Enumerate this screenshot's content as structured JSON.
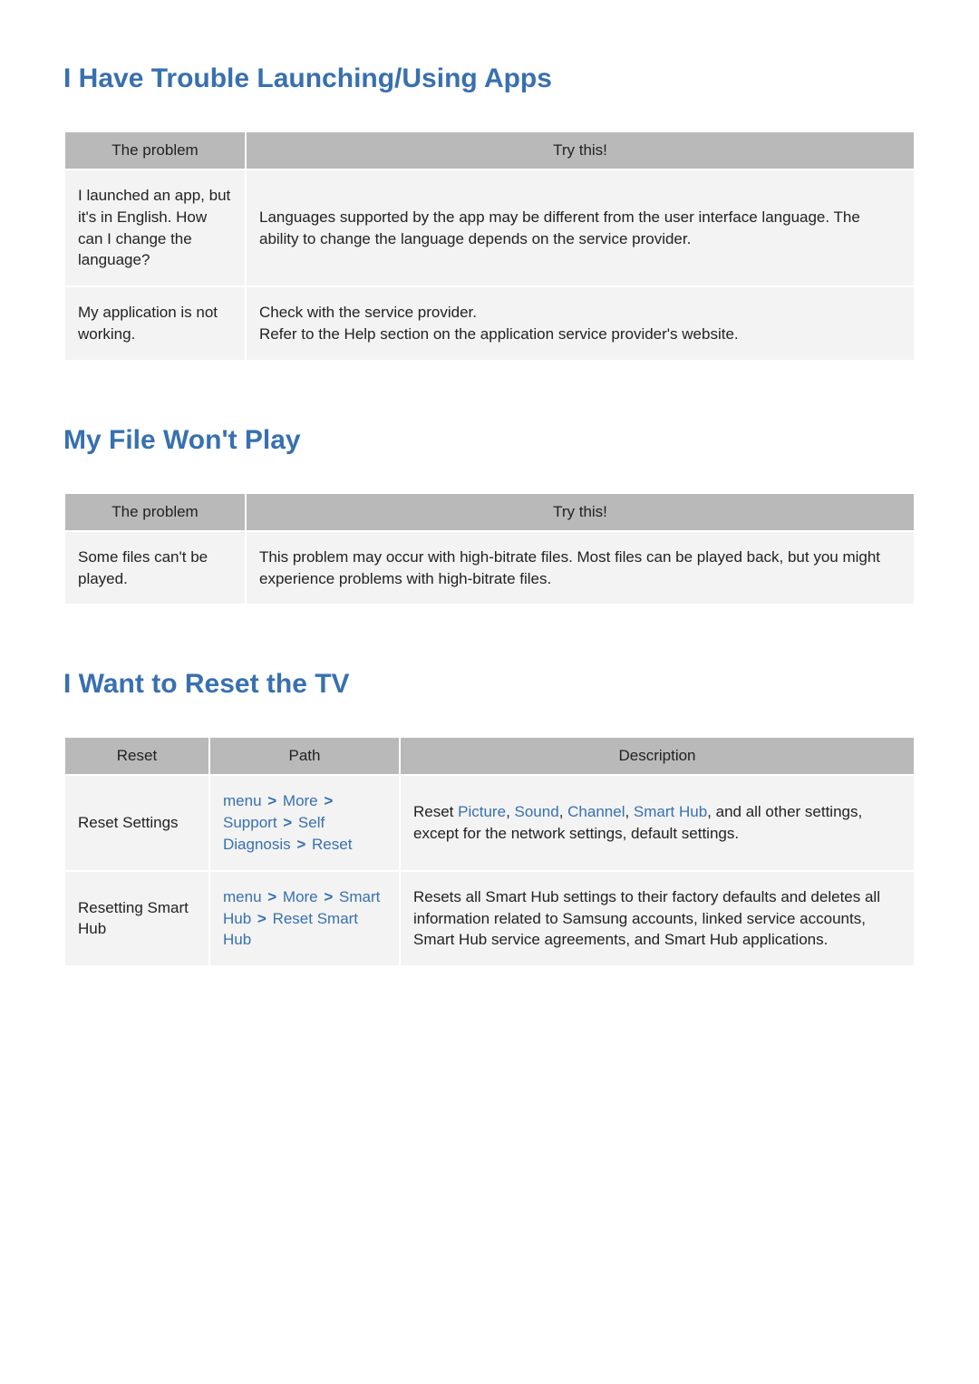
{
  "sections": {
    "apps": {
      "title": "I Have Trouble Launching/Using Apps",
      "headers": {
        "problem": "The problem",
        "try": "Try this!"
      },
      "rows": [
        {
          "problem": "I launched an app, but it's in English. How can I change the language?",
          "try": "Languages supported by the app may be different from the user interface language. The ability to change the language depends on the service provider."
        },
        {
          "problem": "My application is not working.",
          "try": "Check with the service provider.\nRefer to the Help section on the application service provider's website."
        }
      ]
    },
    "file": {
      "title": "My File Won't Play",
      "headers": {
        "problem": "The problem",
        "try": "Try this!"
      },
      "rows": [
        {
          "problem": "Some files can't be played.",
          "try": "This problem may occur with high-bitrate files. Most files can be played back, but you might experience problems with high-bitrate files."
        }
      ]
    },
    "reset": {
      "title": "I Want to Reset the TV",
      "headers": {
        "reset": "Reset",
        "path": "Path",
        "desc": "Description"
      },
      "rows": [
        {
          "reset": "Reset Settings",
          "path": [
            "menu",
            "More",
            "Support",
            "Self Diagnosis",
            "Reset"
          ],
          "desc_parts": [
            {
              "t": "Reset "
            },
            {
              "t": "Picture",
              "link": true
            },
            {
              "t": ", "
            },
            {
              "t": "Sound",
              "link": true
            },
            {
              "t": ", "
            },
            {
              "t": "Channel",
              "link": true
            },
            {
              "t": ", "
            },
            {
              "t": "Smart Hub",
              "link": true
            },
            {
              "t": ", and all other settings, except for the network settings, default settings."
            }
          ]
        },
        {
          "reset": "Resetting Smart Hub",
          "path": [
            "menu",
            "More",
            "Smart Hub",
            "Reset Smart Hub"
          ],
          "desc_parts": [
            {
              "t": "Resets all Smart Hub settings to their factory defaults and deletes all information related to Samsung accounts, linked service accounts, Smart Hub service agreements, and Smart Hub applications."
            }
          ]
        }
      ]
    }
  }
}
